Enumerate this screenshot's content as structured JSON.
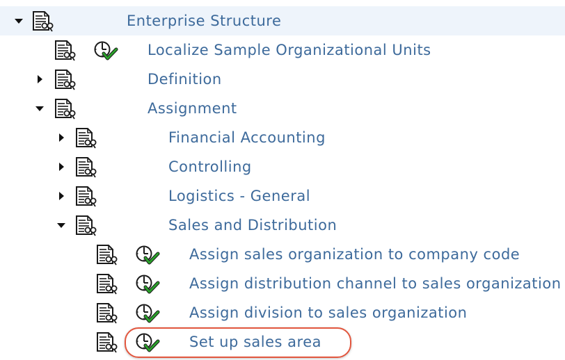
{
  "tree": {
    "root": {
      "label": "Enterprise Structure",
      "expanded": true
    },
    "localize": {
      "label": "Localize Sample Organizational Units"
    },
    "definition": {
      "label": "Definition",
      "expanded": false
    },
    "assignment": {
      "label": "Assignment",
      "expanded": true
    },
    "financial_accounting": {
      "label": "Financial Accounting",
      "expanded": false
    },
    "controlling": {
      "label": "Controlling",
      "expanded": false
    },
    "logistics_general": {
      "label": "Logistics - General",
      "expanded": false
    },
    "sales_distribution": {
      "label": "Sales and Distribution",
      "expanded": true
    },
    "assign_sales_org": {
      "label": "Assign sales organization to company code"
    },
    "assign_dist_channel": {
      "label": "Assign distribution channel to sales organization"
    },
    "assign_division": {
      "label": "Assign division to sales organization"
    },
    "setup_sales_area": {
      "label": "Set up sales area",
      "highlighted": true
    }
  },
  "colors": {
    "label": "#3d6a9b",
    "highlight_border": "#e2563e",
    "check_green": "#2aa12a",
    "root_row_bg": "#eef4fb"
  },
  "icons": {
    "doc": "document-with-glasses-icon",
    "execute": "clock-with-checkmark-icon",
    "expand": "triangle-right-icon",
    "collapse": "triangle-down-icon"
  }
}
